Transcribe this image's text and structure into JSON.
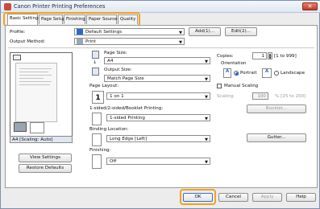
{
  "window": {
    "title": "Canon Printer Printing Preferences",
    "close_glyph": "✕"
  },
  "tabs": [
    {
      "label": "Basic Settings"
    },
    {
      "label": "Page Setup"
    },
    {
      "label": "Finishing"
    },
    {
      "label": "Paper Source"
    },
    {
      "label": "Quality"
    }
  ],
  "profile": {
    "label": "Profile:",
    "value": "Default Settings",
    "add_button": "Add(1)...",
    "edit_button": "Edit(2)..."
  },
  "output_method": {
    "label": "Output Method:",
    "value": "Print"
  },
  "preview": {
    "caption": "A4 [Scaling: Auto]",
    "view_settings_button": "View Settings",
    "restore_defaults_button": "Restore Defaults"
  },
  "page_size": {
    "label": "Page Size:",
    "value": "A4"
  },
  "output_size": {
    "label": "Output Size:",
    "value": "Match Page Size"
  },
  "copies": {
    "label": "Copies:",
    "value": "1",
    "range": "[1 to 999]"
  },
  "orientation": {
    "label": "Orientation",
    "portrait": "Portrait",
    "landscape": "Landscape",
    "selected": "Portrait"
  },
  "page_layout": {
    "label": "Page Layout:",
    "value": "1 on 1",
    "icon_text": "1"
  },
  "manual_scaling": {
    "label": "Manual Scaling",
    "checked": false,
    "scaling_label": "Scaling:",
    "scaling_value": "100",
    "scaling_range": "% [25 to 200]"
  },
  "duplex": {
    "label": "1-sided/2-sided/Booklet Printing:",
    "value": "1-sided Printing",
    "booklet_button": "Booklet..."
  },
  "binding": {
    "label": "Binding Location:",
    "value": "Long Edge [Left]",
    "gutter_button": "Gutter..."
  },
  "finishing": {
    "label": "Finishing:",
    "value": "Off"
  },
  "footer": {
    "ok": "OK",
    "cancel": "Cancel",
    "apply": "Apply",
    "help": "Help"
  },
  "colors": {
    "highlight": "#f2a21b",
    "accent": "#2a6ac5",
    "titlebar": "#dfe7f2"
  }
}
